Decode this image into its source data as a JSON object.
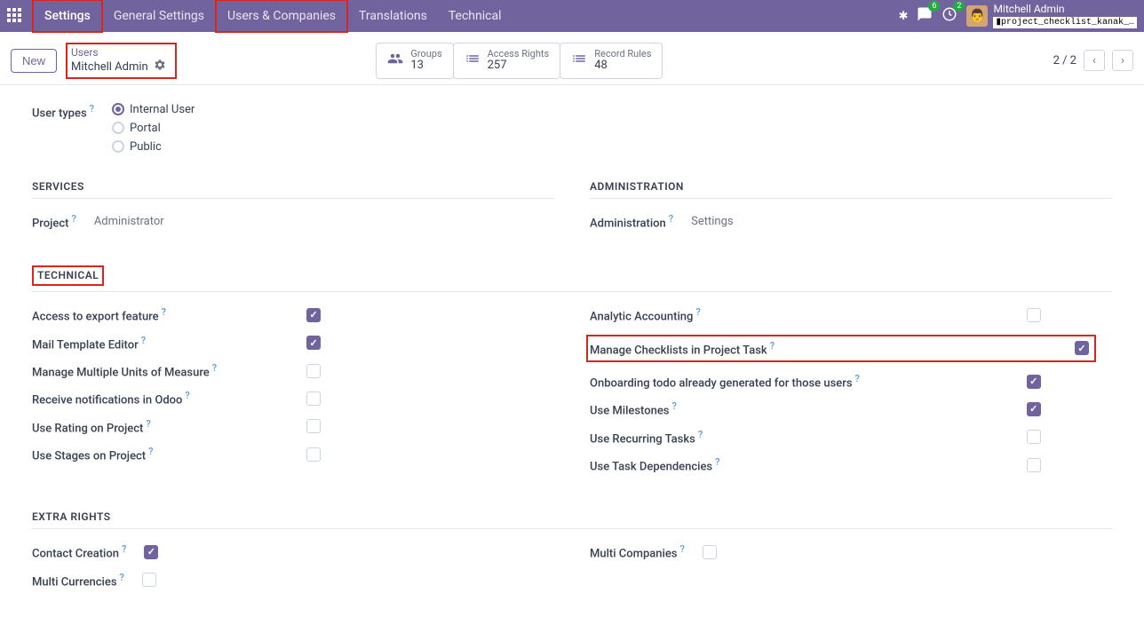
{
  "topbar": {
    "app_name": "Settings",
    "menu": [
      {
        "label": "General Settings"
      },
      {
        "label": "Users & Companies"
      },
      {
        "label": "Translations"
      },
      {
        "label": "Technical"
      }
    ],
    "chat_badge": "6",
    "activity_badge": "2",
    "user_name": "Mitchell Admin",
    "db_name": "▮project_checklist_kanak_…"
  },
  "subbar": {
    "new_label": "New",
    "breadcrumb_top": "Users",
    "breadcrumb_name": "Mitchell Admin",
    "stats": [
      {
        "label": "Groups",
        "count": "13"
      },
      {
        "label": "Access Rights",
        "count": "257"
      },
      {
        "label": "Record Rules",
        "count": "48"
      }
    ],
    "pager": "2 / 2"
  },
  "user_types": {
    "label": "User types",
    "options": [
      {
        "label": "Internal User",
        "checked": true
      },
      {
        "label": "Portal",
        "checked": false
      },
      {
        "label": "Public",
        "checked": false
      }
    ]
  },
  "services": {
    "title": "SERVICES",
    "project_label": "Project",
    "project_value": "Administrator"
  },
  "administration": {
    "title": "ADMINISTRATION",
    "admin_label": "Administration",
    "admin_value": "Settings"
  },
  "technical": {
    "title": "TECHNICAL",
    "left": [
      {
        "label": "Access to export feature",
        "checked": true
      },
      {
        "label": "Mail Template Editor",
        "checked": true
      },
      {
        "label": "Manage Multiple Units of Measure",
        "checked": false
      },
      {
        "label": "Receive notifications in Odoo",
        "checked": false
      },
      {
        "label": "Use Rating on Project",
        "checked": false
      },
      {
        "label": "Use Stages on Project",
        "checked": false
      }
    ],
    "right": [
      {
        "label": "Analytic Accounting",
        "checked": false
      },
      {
        "label": "Manage Checklists in Project Task",
        "checked": true
      },
      {
        "label": "Onboarding todo already generated for those users",
        "checked": true
      },
      {
        "label": "Use Milestones",
        "checked": true
      },
      {
        "label": "Use Recurring Tasks",
        "checked": false
      },
      {
        "label": "Use Task Dependencies",
        "checked": false
      }
    ]
  },
  "extra_rights": {
    "title": "EXTRA RIGHTS",
    "left": [
      {
        "label": "Contact Creation",
        "checked": true
      },
      {
        "label": "Multi Currencies",
        "checked": false
      }
    ],
    "right": [
      {
        "label": "Multi Companies",
        "checked": false
      }
    ]
  }
}
